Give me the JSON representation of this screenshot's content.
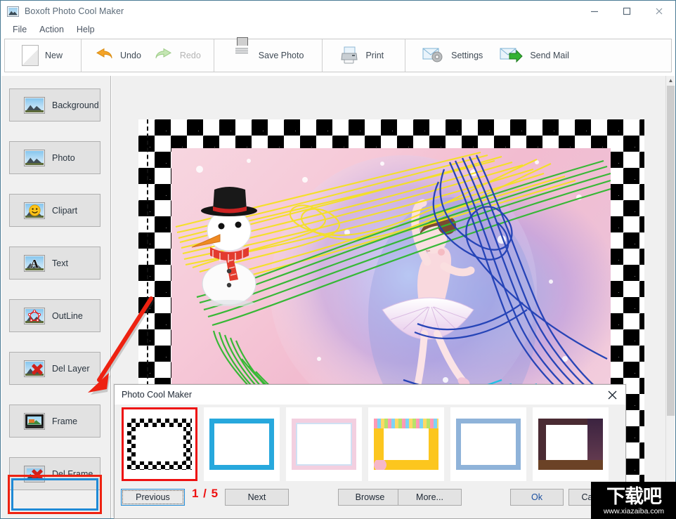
{
  "window": {
    "title": "Boxoft Photo Cool Maker",
    "icon": "app-photo-icon",
    "minimize": "—",
    "maximize": "□",
    "close": "✕"
  },
  "menubar": {
    "items": [
      {
        "label": "File"
      },
      {
        "label": "Action"
      },
      {
        "label": "Help"
      }
    ]
  },
  "toolbar": {
    "groups": [
      {
        "buttons": [
          {
            "label": "New",
            "icon": "new-page-icon",
            "enabled": true
          }
        ]
      },
      {
        "buttons": [
          {
            "label": "Undo",
            "icon": "undo-arrow-icon",
            "enabled": true
          },
          {
            "label": "Redo",
            "icon": "redo-arrow-icon",
            "enabled": false
          }
        ]
      },
      {
        "buttons": [
          {
            "label": "Save Photo",
            "icon": "floppy-disk-icon",
            "enabled": true
          }
        ]
      },
      {
        "buttons": [
          {
            "label": "Print",
            "icon": "printer-icon",
            "enabled": true
          }
        ]
      },
      {
        "buttons": [
          {
            "label": "Settings",
            "icon": "envelope-gear-icon",
            "enabled": true
          },
          {
            "label": "Send Mail",
            "icon": "envelope-arrow-icon",
            "enabled": true
          }
        ]
      }
    ]
  },
  "sidebar": {
    "items": [
      {
        "label": "Background",
        "icon": "photo-icon",
        "selected": false
      },
      {
        "label": "Photo",
        "icon": "photo-icon",
        "selected": false
      },
      {
        "label": "Clipart",
        "icon": "smiley-photo-icon",
        "selected": false
      },
      {
        "label": "Text",
        "icon": "letter-a-photo-icon",
        "selected": false
      },
      {
        "label": "OutLine",
        "icon": "outline-shape-photo-icon",
        "selected": false
      },
      {
        "label": "Del Layer",
        "icon": "photo-delete-icon",
        "selected": false
      },
      {
        "label": "Frame",
        "icon": "frame-photo-icon",
        "selected": true
      },
      {
        "label": "Del Frame",
        "icon": "frame-delete-icon",
        "selected": false
      }
    ]
  },
  "canvas": {
    "frame_style": "checkerboard",
    "photo_description": "ballerina and snowman illustration with colorful scribble strokes"
  },
  "dialog": {
    "title": "Photo Cool Maker",
    "close_label": "✕",
    "thumbnails": [
      {
        "name": "checkerboard-frame",
        "selected": true
      },
      {
        "name": "blue-border-frame",
        "selected": false
      },
      {
        "name": "pink-lace-frame",
        "selected": false
      },
      {
        "name": "yellow-party-frame",
        "selected": false
      },
      {
        "name": "blue-pattern-frame",
        "selected": false
      },
      {
        "name": "room-scene-frame",
        "selected": false
      }
    ],
    "buttons": {
      "previous": "Previous",
      "next": "Next",
      "browse": "Browse",
      "more": "More...",
      "ok": "Ok",
      "cancel": "Cancel"
    },
    "page_indicator": "1  /  5",
    "page_current": "1",
    "page_total": "5"
  },
  "annotations": {
    "arrow_color": "#ee2211",
    "highlight_color": "#ee2211",
    "selection_color": "#1f8ad6"
  },
  "watermark": {
    "text": "下载吧",
    "url": "www.xiazaiba.com"
  }
}
